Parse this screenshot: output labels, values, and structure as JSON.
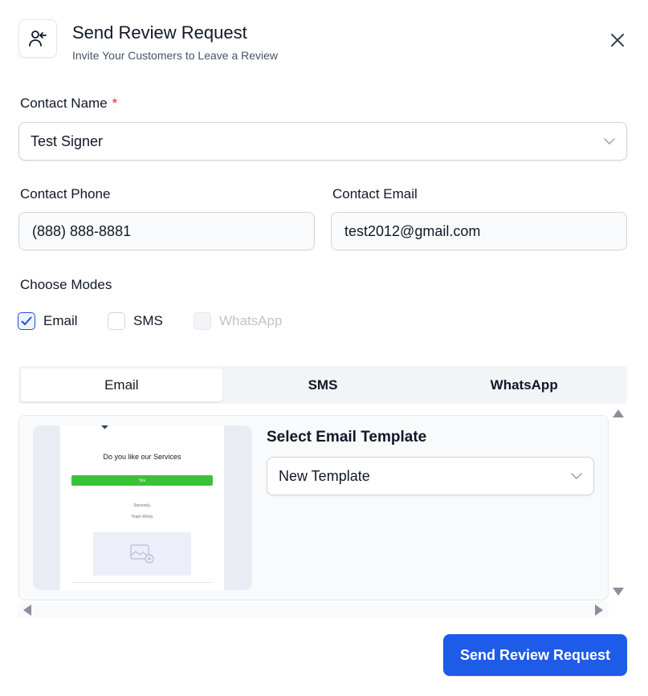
{
  "header": {
    "title": "Send Review Request",
    "subtitle": "Invite Your Customers to Leave a Review",
    "icon": "user-return-icon",
    "close_icon": "close-icon"
  },
  "form": {
    "contact_name": {
      "label": "Contact Name",
      "required_mark": "*",
      "value": "Test Signer"
    },
    "contact_phone": {
      "label": "Contact Phone",
      "value": "(888) 888-8881"
    },
    "contact_email": {
      "label": "Contact Email",
      "value": "test2012@gmail.com"
    },
    "modes": {
      "label": "Choose Modes",
      "options": [
        {
          "label": "Email",
          "checked": true,
          "disabled": false
        },
        {
          "label": "SMS",
          "checked": false,
          "disabled": false
        },
        {
          "label": "WhatsApp",
          "checked": false,
          "disabled": true
        }
      ]
    }
  },
  "tabs": [
    {
      "label": "Email",
      "active": true
    },
    {
      "label": "SMS",
      "active": false
    },
    {
      "label": "WhatsApp",
      "active": false
    }
  ],
  "email_panel": {
    "template_label": "Select Email Template",
    "template_value": "New Template",
    "preview": {
      "heading": "Do you like our Services",
      "button": "Yes",
      "signoff": "Sincerely,",
      "signer": "Team Wolvy"
    }
  },
  "footer": {
    "send_label": "Send Review Request"
  },
  "colors": {
    "primary": "#1d5be8",
    "required": "#d92d20",
    "preview_button": "#3cc13b"
  }
}
